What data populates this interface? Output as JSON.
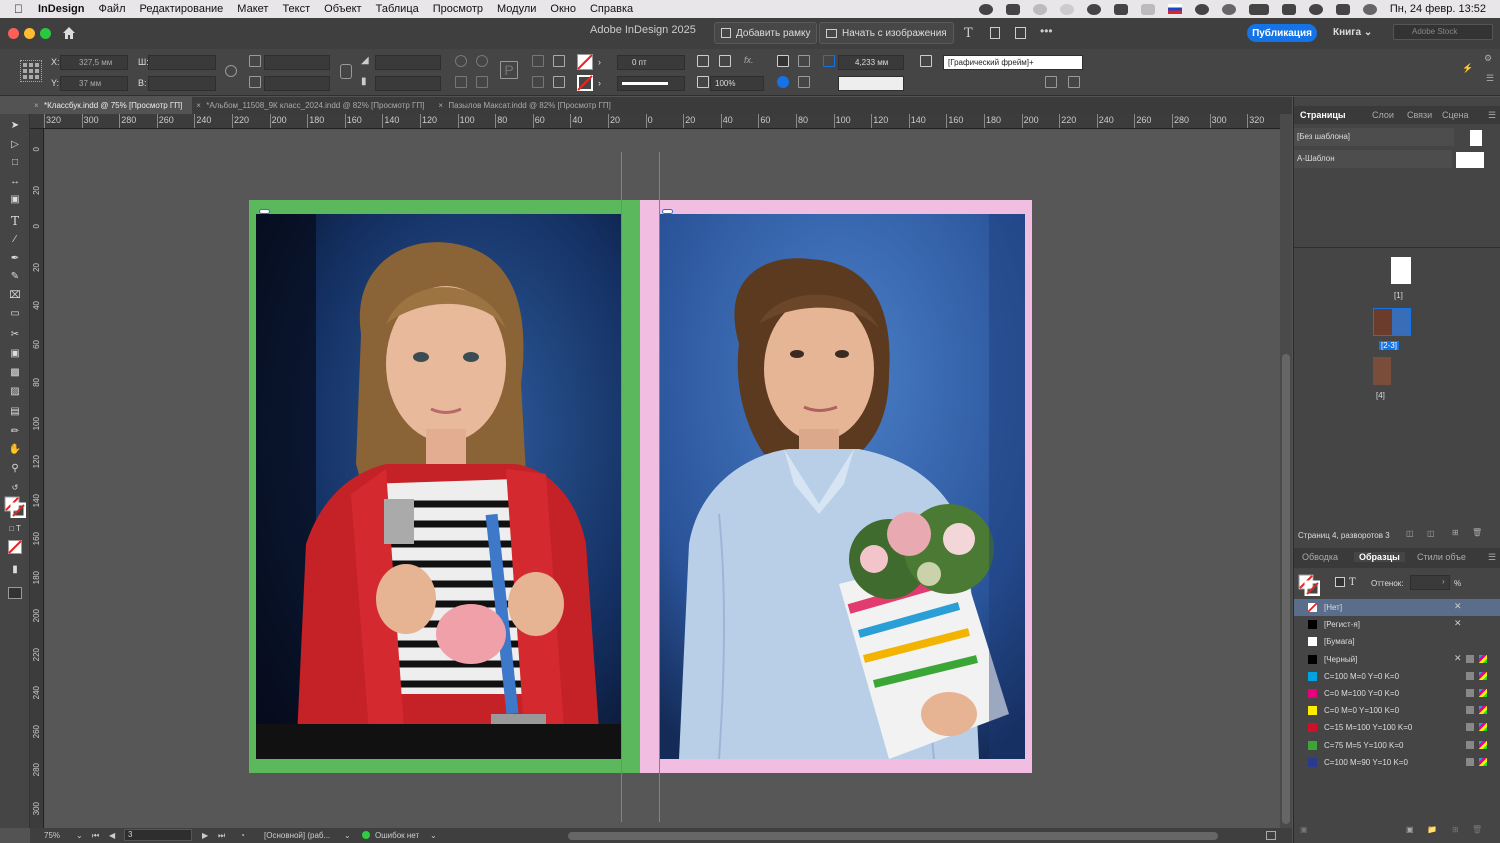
{
  "menubar": {
    "app_name": "InDesign",
    "items": [
      "Файл",
      "Редактирование",
      "Макет",
      "Текст",
      "Объект",
      "Таблица",
      "Просмотр",
      "Модули",
      "Окно",
      "Справка"
    ],
    "datetime": "Пн, 24 февр.  13:52"
  },
  "titlebar": {
    "title": "Adobe InDesign 2025",
    "add_frame": "Добавить рамку",
    "start_with_images": "Начать с изображения",
    "publish": "Публикация",
    "book": "Книга",
    "stock_search_placeholder": "Adobe Stock"
  },
  "control": {
    "x_label": "X:",
    "x_value": "327,5 мм",
    "y_label": "Y:",
    "y_value": "37 мм",
    "w_label": "Ш:",
    "h_label": "В:",
    "stroke_weight": "0 пт",
    "scale_percent": "100%",
    "size_value": "4,233 мм",
    "frame_type": "[Графический фрейм]+"
  },
  "tabs": [
    {
      "label": "*Классбук.indd @ 75% [Просмотр ГП]",
      "active": true
    },
    {
      "label": "*Альбом_11508_9К класс_2024.indd @ 82% [Просмотр ГП]",
      "active": false
    },
    {
      "label": "Пазылов Максат.indd @ 82% [Просмотр ГП]",
      "active": false
    }
  ],
  "ruler": {
    "h_ticks": [
      "320",
      "300",
      "280",
      "260",
      "240",
      "220",
      "200",
      "180",
      "160",
      "140",
      "120",
      "100",
      "80",
      "60",
      "40",
      "20",
      "0",
      "20",
      "40",
      "60",
      "80",
      "100",
      "120",
      "140",
      "160",
      "180",
      "200",
      "220",
      "240",
      "260",
      "280",
      "300",
      "320"
    ],
    "v_ticks": [
      "0",
      "20",
      "0",
      "20",
      "40",
      "60",
      "80",
      "100",
      "120",
      "140",
      "160",
      "180",
      "200",
      "220",
      "240",
      "260",
      "280",
      "300"
    ]
  },
  "status": {
    "zoom": "75%",
    "page": "3",
    "layer": "[Основной] (раб...",
    "errors": "Ошибок нет"
  },
  "pages_panel": {
    "tabs": [
      "Страницы",
      "Слои",
      "Связи",
      "Сцена"
    ],
    "masters": [
      "[Без шаблона]",
      "А-Шаблон"
    ],
    "page_labels": [
      "[1]",
      "[2-3]",
      "[4]"
    ],
    "summary": "Страниц 4, разворотов 3"
  },
  "swatches_panel": {
    "tabs": [
      "Обводка",
      "Образцы",
      "Стили объе"
    ],
    "tint_label": "Оттенок:",
    "tint_unit": "%",
    "swatches": [
      {
        "name": "[Нет]",
        "color": "#ffffff"
      },
      {
        "name": "[Регист-я]",
        "color": "#000000"
      },
      {
        "name": "[Бумага]",
        "color": "#ffffff"
      },
      {
        "name": "[Черный]",
        "color": "#000000"
      },
      {
        "name": "C=100 M=0 Y=0 K=0",
        "color": "#00a3e0"
      },
      {
        "name": "C=0 M=100 Y=0 K=0",
        "color": "#e6007e"
      },
      {
        "name": "C=0 M=0 Y=100 K=0",
        "color": "#ffed00"
      },
      {
        "name": "C=15 M=100 Y=100 K=0",
        "color": "#d0102a"
      },
      {
        "name": "C=75 M=5 Y=100 K=0",
        "color": "#3aa635"
      },
      {
        "name": "C=100 M=90 Y=10 K=0",
        "color": "#2b3a8f"
      }
    ]
  },
  "colors": {
    "left_page_frame": "#5cb85c",
    "right_page_frame": "#f1bde0",
    "guide": "#2aa7b5",
    "accent": "#1473e6"
  }
}
